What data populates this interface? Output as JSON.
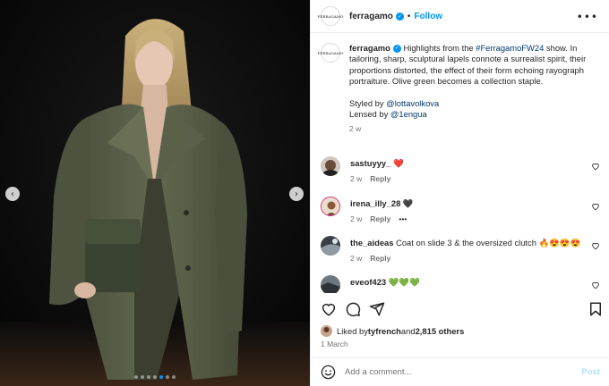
{
  "post": {
    "username": "ferragamo",
    "avatar_text": "FERRAGAMO",
    "follow_label": "Follow",
    "bullet": "•",
    "verified_glyph": "✓",
    "more_icon": "more-options-icon"
  },
  "caption": {
    "username": "ferragamo",
    "text_before": " Highlights from the ",
    "hashtag": "#FerragamoFW24",
    "text_after": " show. In tailoring, sharp, sculptural lapels connote a surrealist spirit, their proportions distorted, the effect of their form echoing rayograph portraiture. Olive green becomes a collection staple.",
    "styled_label": "Styled by ",
    "styled_by": "@lottavolkova",
    "lensed_label": "Lensed by ",
    "lensed_by": "@1engua",
    "time": "2 w"
  },
  "comments": [
    {
      "username": "sastuyyy_",
      "text": "❤️",
      "time": "2 w",
      "reply": "Reply",
      "more": ""
    },
    {
      "username": "irena_illy_28",
      "text": "🖤",
      "time": "2 w",
      "reply": "Reply",
      "more": "•••"
    },
    {
      "username": "the_aideas",
      "text": "Coat on slide 3 & the oversized clutch 🔥😍😍😍",
      "time": "2 w",
      "reply": "Reply",
      "more": ""
    },
    {
      "username": "eveof423",
      "text": "💚💚💚",
      "time": "",
      "reply": "",
      "more": ""
    }
  ],
  "likes": {
    "prefix": "Liked by ",
    "user": "tyfrench",
    "middle": " and ",
    "count": "2,815 others"
  },
  "date": "1 March",
  "composer": {
    "placeholder": "Add a comment...",
    "post_label": "Post"
  },
  "carousel": {
    "prev_glyph": "‹",
    "next_glyph": "›",
    "slide_count": 7,
    "active_slide": 5
  },
  "colors": {
    "accent": "#0095f6",
    "link": "#00376b",
    "muted": "#737373",
    "heart_red": "#ed4956"
  }
}
